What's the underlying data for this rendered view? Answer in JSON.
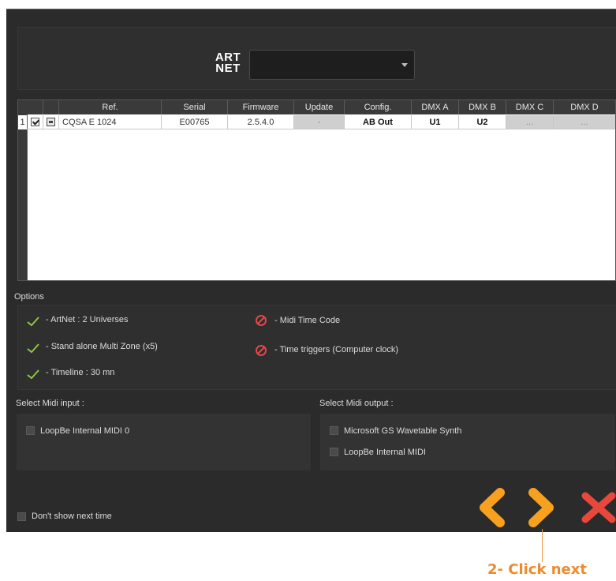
{
  "artnet": {
    "logo_line1": "ART",
    "logo_line2": "NET",
    "selected": ""
  },
  "table": {
    "headers": [
      "Ref.",
      "Serial",
      "Firmware",
      "Update",
      "Config.",
      "DMX A",
      "DMX B",
      "DMX C",
      "DMX D"
    ],
    "rows": [
      {
        "index": "1",
        "checked": true,
        "ref": "CQSA E 1024",
        "serial": "E00765",
        "firmware": "2.5.4.0",
        "update": "-",
        "config": "AB Out",
        "dmx_a": "U1",
        "dmx_b": "U2",
        "dmx_c": "...",
        "dmx_d": "..."
      }
    ]
  },
  "options": {
    "label": "Options",
    "items": [
      {
        "text": "- ArtNet : 2 Universes",
        "enabled": true
      },
      {
        "text": "- Stand alone Multi Zone (x5)",
        "enabled": true
      },
      {
        "text": "- Timeline : 30 mn",
        "enabled": true
      },
      {
        "text": "- Midi Time Code",
        "enabled": false
      },
      {
        "text": "- Time triggers (Computer clock)",
        "enabled": false
      }
    ]
  },
  "midi_input": {
    "label": "Select Midi input :",
    "items": [
      "LoopBe Internal MIDI 0"
    ]
  },
  "midi_output": {
    "label": "Select Midi output :",
    "items": [
      "Microsoft GS Wavetable Synth",
      "LoopBe Internal MIDI"
    ]
  },
  "footer": {
    "dont_show": "Don't show next time"
  },
  "annotation": {
    "text": "2- Click next"
  },
  "colors": {
    "accent": "#f7a11e",
    "close": "#e8473b",
    "ok": "#8ec63f",
    "forbidden": "#e04848"
  }
}
